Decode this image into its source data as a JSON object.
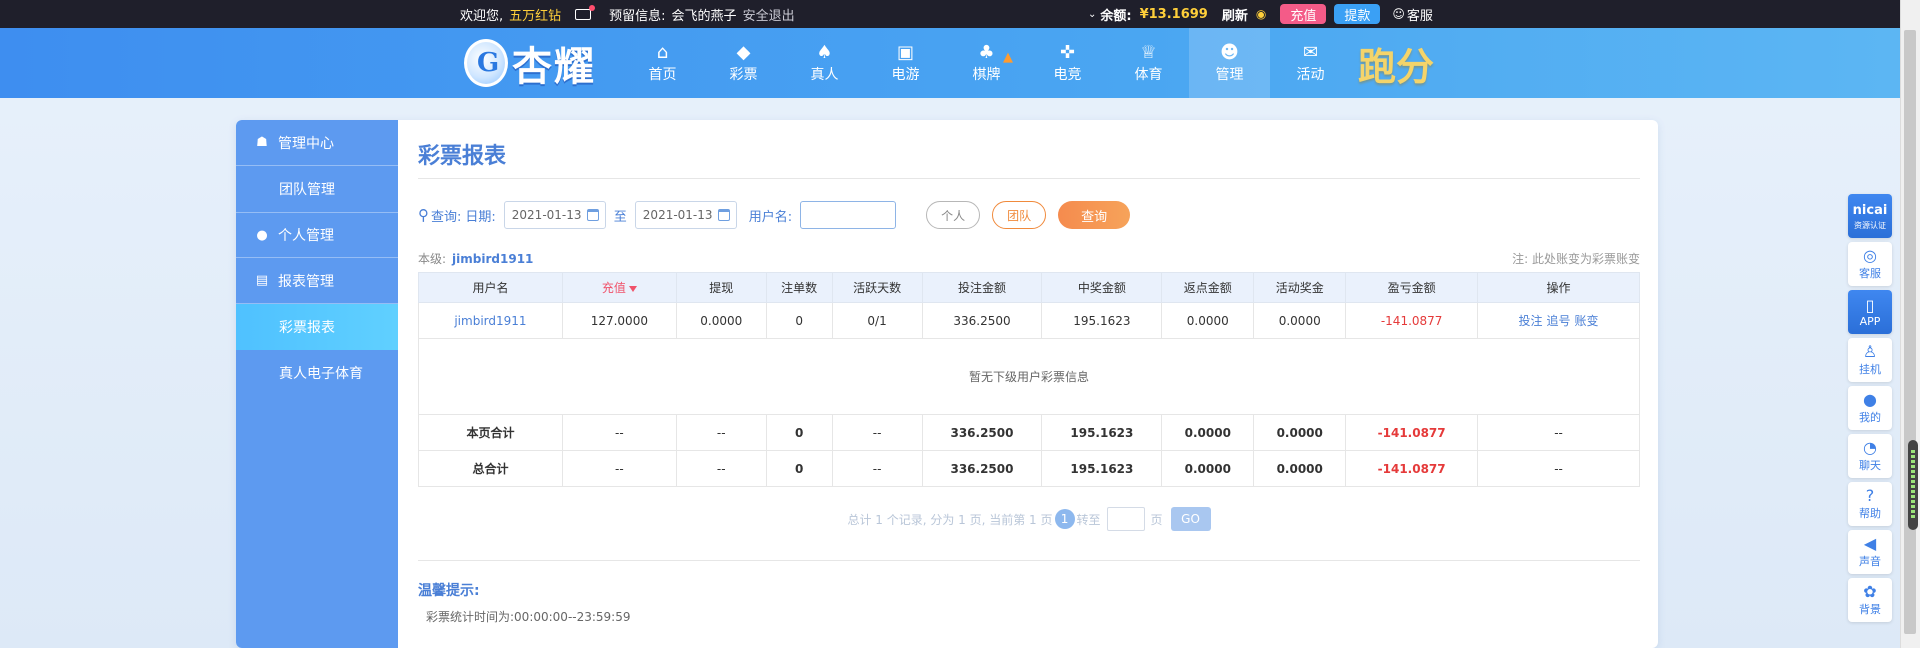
{
  "topbar": {
    "welcome": "欢迎您,",
    "username": "五万红钻",
    "notice_label": "预留信息:",
    "notice_value": "会飞的燕子",
    "logout": "安全退出",
    "balance_label": "余额:",
    "balance_value": "¥13.1699",
    "refresh": "刷新",
    "recharge": "充值",
    "withdraw": "提款",
    "service": "客服"
  },
  "header": {
    "logo_text": "杏耀",
    "nav": [
      {
        "label": "首页",
        "icon": "home-icon"
      },
      {
        "label": "彩票",
        "icon": "lottery-icon"
      },
      {
        "label": "真人",
        "icon": "live-casino-icon"
      },
      {
        "label": "电游",
        "icon": "slot-icon"
      },
      {
        "label": "棋牌",
        "icon": "cards-icon"
      },
      {
        "label": "电竞",
        "icon": "gamepad-icon"
      },
      {
        "label": "体育",
        "icon": "trophy-icon"
      },
      {
        "label": "管理",
        "icon": "users-icon"
      },
      {
        "label": "活动",
        "icon": "gift-icon"
      }
    ],
    "promo": "跑分"
  },
  "sidebar": {
    "items": [
      {
        "label": "管理中心",
        "type": "group",
        "icon": "team-icon"
      },
      {
        "label": "团队管理",
        "type": "sub"
      },
      {
        "label": "个人管理",
        "type": "group",
        "icon": "person-icon"
      },
      {
        "label": "报表管理",
        "type": "group",
        "icon": "report-icon"
      },
      {
        "label": "彩票报表",
        "type": "sub",
        "active": true
      },
      {
        "label": "真人电子体育",
        "type": "sub"
      }
    ]
  },
  "main": {
    "title": "彩票报表",
    "filter": {
      "query_label": "查询:",
      "date_label": "日期:",
      "date_from": "2021-01-13",
      "to_label": "至",
      "date_to": "2021-01-13",
      "user_label": "用户名:",
      "user_value": "",
      "personal": "个人",
      "team": "团队",
      "search": "查询"
    },
    "level_label": "本级:",
    "level_user": "jimbird1911",
    "note": "注: 此处账变为彩票账变",
    "table": {
      "headers": [
        "用户名",
        "充值",
        "提现",
        "注单数",
        "活跃天数",
        "投注金额",
        "中奖金额",
        "返点金额",
        "活动奖金",
        "盈亏金额",
        "操作"
      ],
      "row": {
        "user": "jimbird1911",
        "recharge": "127.0000",
        "withdraw": "0.0000",
        "orders": "0",
        "active_days": "0/1",
        "bet": "336.2500",
        "win": "195.1623",
        "rebate": "0.0000",
        "bonus": "0.0000",
        "profit": "-141.0877",
        "op_bet": "投注",
        "op_chase": "追号",
        "op_ledger": "账变"
      },
      "empty_text": "暂无下级用户彩票信息",
      "page_total": {
        "label": "本页合计",
        "recharge": "--",
        "withdraw": "--",
        "orders": "0",
        "active_days": "--",
        "bet": "336.2500",
        "win": "195.1623",
        "rebate": "0.0000",
        "bonus": "0.0000",
        "profit": "-141.0877",
        "ops": "--"
      },
      "grand_total": {
        "label": "总合计",
        "recharge": "--",
        "withdraw": "--",
        "orders": "0",
        "active_days": "--",
        "bet": "336.2500",
        "win": "195.1623",
        "rebate": "0.0000",
        "bonus": "0.0000",
        "profit": "-141.0877",
        "ops": "--"
      }
    },
    "pager": {
      "summary": "总计 1 个记录, 分为 1 页, 当前第 1 页",
      "current": "1",
      "goto_label": "转至",
      "page_unit": "页",
      "go": "GO"
    },
    "tips_title": "温馨提示:",
    "tips_text": "彩票统计时间为:00:00:00--23:59:59"
  },
  "right_tools": [
    {
      "label": "nicai",
      "caption": "资源认证",
      "icon": "cert-icon"
    },
    {
      "label": "客服",
      "icon": "headset-icon"
    },
    {
      "label": "APP",
      "icon": "phone-icon"
    },
    {
      "label": "挂机",
      "icon": "robot-icon"
    },
    {
      "label": "我的",
      "icon": "user-icon"
    },
    {
      "label": "聊天",
      "icon": "chat-icon"
    },
    {
      "label": "帮助",
      "icon": "help-icon"
    },
    {
      "label": "声音",
      "icon": "speaker-icon"
    },
    {
      "label": "背景",
      "icon": "palette-icon"
    }
  ],
  "colors": {
    "header_blue": "#3e8ef0",
    "sidebar_blue": "#5d9af0",
    "active_cyan": "#4fc1ff",
    "title_blue": "#4a7fd6",
    "negative_red": "#e53a3a",
    "query_orange": "#f58b4e",
    "gold": "#ffcf3a"
  }
}
